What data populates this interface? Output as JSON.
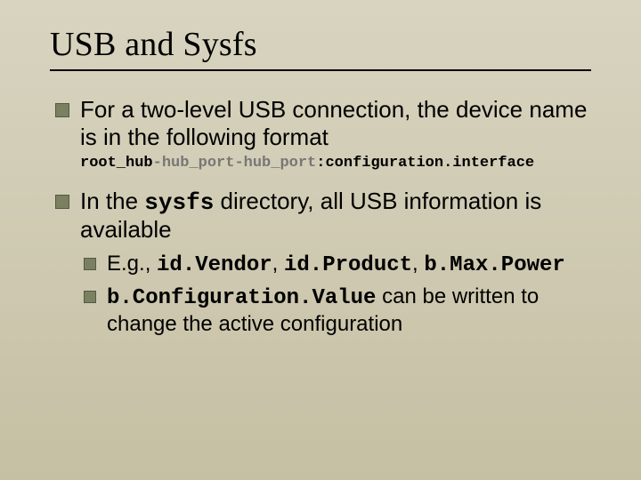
{
  "title": "USB and Sysfs",
  "bullets": [
    {
      "text_a": "For a two-level USB connection, the device name is in the following format",
      "code": {
        "p1": "root_hub",
        "p2": "-hub_port-hub_port",
        "p3": ":configuration.interface"
      }
    },
    {
      "text_a": "In the ",
      "mono_a": "sysfs",
      "text_b": " directory, all USB information is available",
      "subs": [
        {
          "pre": "E.g., ",
          "m1": "id.Vendor",
          "s1": ", ",
          "m2": "id.Product",
          "s2": ", ",
          "m3": "b.Max.Power"
        },
        {
          "m1": "b.Configuration.Value",
          "post": " can be written to change the active configuration"
        }
      ]
    }
  ]
}
